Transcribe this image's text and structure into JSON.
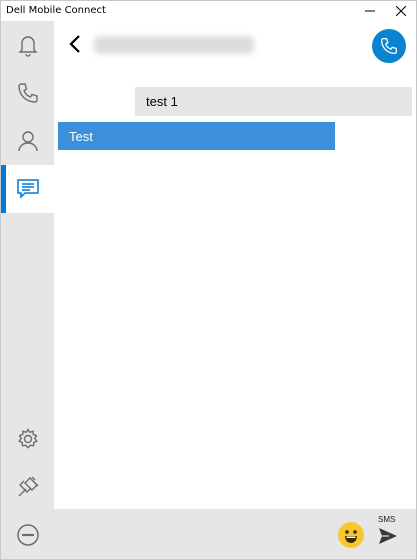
{
  "window": {
    "title": "Dell Mobile Connect",
    "controls": {
      "minimize_icon": "minimize-icon",
      "close_icon": "close-icon"
    }
  },
  "sidebar": {
    "items": [
      {
        "name": "notifications",
        "icon": "bell-icon",
        "active": false
      },
      {
        "name": "calls",
        "icon": "phone-icon",
        "active": false
      },
      {
        "name": "contacts",
        "icon": "person-icon",
        "active": false
      },
      {
        "name": "messages",
        "icon": "message-icon",
        "active": true
      },
      {
        "name": "settings",
        "icon": "gear-icon",
        "active": false
      },
      {
        "name": "connection",
        "icon": "plug-icon",
        "active": false
      },
      {
        "name": "do-not-disturb",
        "icon": "minus-circle-icon",
        "active": false
      }
    ]
  },
  "header": {
    "back_icon": "chevron-left-icon",
    "contact_name_redacted": true,
    "call_icon": "phone-icon"
  },
  "messages": [
    {
      "text": "test 1",
      "direction": "outgoing"
    },
    {
      "text": "Test",
      "direction": "incoming"
    }
  ],
  "compose": {
    "emoji_icon": "emoji-icon",
    "send_mode_label": "SMS",
    "send_icon": "send-icon"
  },
  "colors": {
    "accent": "#0078d7",
    "call_button": "#0a84d0",
    "incoming_bubble": "#3b8fdb",
    "outgoing_bubble": "#e5e5e5",
    "sidebar_bg": "#e6e6e6"
  }
}
